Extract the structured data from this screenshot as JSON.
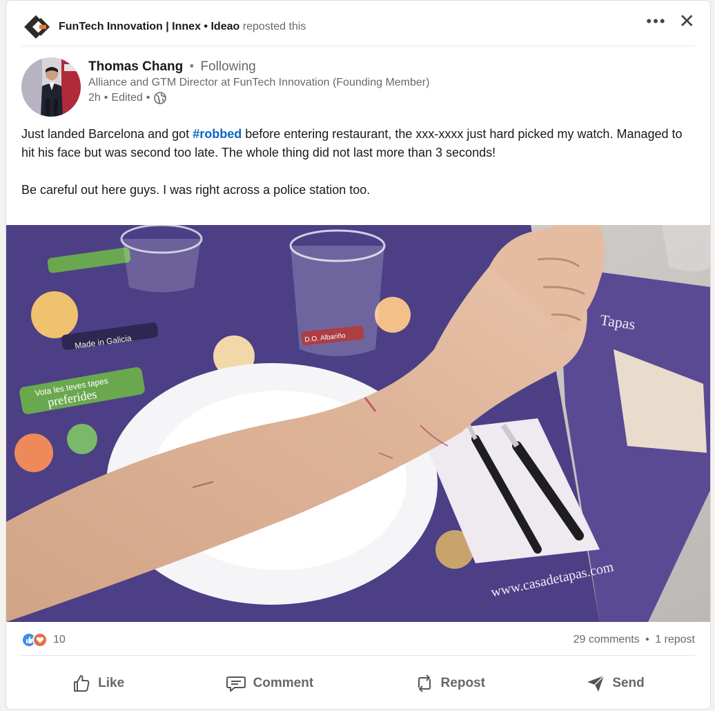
{
  "repost": {
    "company": "FunTech Innovation | Innex",
    "bullet": "•",
    "reposter": "Ideao",
    "action_text": "reposted this",
    "logo_icon": "company-logo-icon"
  },
  "author": {
    "name": "Thomas Chang",
    "sep": "•",
    "follow_status": "Following",
    "headline": "Alliance and GTM Director at FunTech Innovation (Founding Member)",
    "time": "2h",
    "dot": "•",
    "edited": "Edited",
    "dot2": "•",
    "visibility_icon": "globe-icon"
  },
  "post": {
    "line1_before": "Just landed Barcelona and got ",
    "hashtag": "#robbed",
    "line1_after": " before entering restaurant, the xxx-xxxx just hard picked my watch. Managed to hit his face but was second too late. The whole thing did not last more than 3 seconds!",
    "line2": "Be careful out here guys. I was right across a police station too."
  },
  "photo": {
    "placemat_text_1": "Made in Galicia",
    "placemat_text_2": "Vota les teves tapes",
    "placemat_text_3": "preferides",
    "placemat_text_4": "www.casadetapas.com",
    "placemat_text_5": "Tapas",
    "placemat_text_6": "D.O. Albariño"
  },
  "social": {
    "reaction_count": "10",
    "comments": "29 comments",
    "sep": "•",
    "reposts": "1 repost"
  },
  "actions": {
    "like": "Like",
    "comment": "Comment",
    "repost": "Repost",
    "send": "Send"
  },
  "colors": {
    "link": "#0a66c2",
    "placemat": "#4c3f86"
  }
}
